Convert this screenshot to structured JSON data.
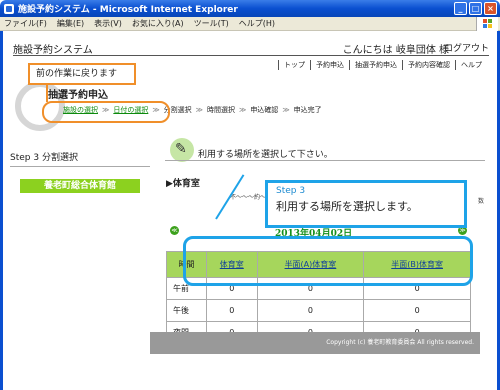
{
  "window": {
    "title": "施設予約システム - Microsoft Internet Explorer",
    "min": "_",
    "max": "□",
    "close": "×"
  },
  "menubar": [
    "ファイル(F)",
    "編集(E)",
    "表示(V)",
    "お気に入り(A)",
    "ツール(T)",
    "ヘルプ(H)"
  ],
  "header": {
    "site_title": "施設予約システム",
    "greeting": "こんにちは 岐阜団体 様",
    "logout": "ログアウト"
  },
  "topnav": [
    "トップ",
    "予約申込",
    "抽選予約申込",
    "予約内容確認",
    "ヘルプ"
  ],
  "page_heading": "抽選予約申込",
  "steps": {
    "done": [
      "施設の選択",
      "日付の選択"
    ],
    "pending": [
      "分割選択",
      "時間選択",
      "申込確認",
      "申込完了"
    ],
    "sep": "≫"
  },
  "left": {
    "step_label": "Step 3  分割選択",
    "facility": "養老町総合体育館"
  },
  "instruction": "利用する場所を選択して下さい。",
  "room_label": "▶体育室",
  "notice": "不〜〜〜約〜〜〜",
  "notice_right": "数",
  "date": "2013年04月02日",
  "nav_prev": "≪",
  "nav_next": "≫",
  "table": {
    "headers": [
      "時間",
      "体育室",
      "半面(A)体育室",
      "半面(B)体育室"
    ],
    "rows": [
      {
        "time": "午前",
        "vals": [
          "0",
          "0",
          "0"
        ]
      },
      {
        "time": "午後",
        "vals": [
          "0",
          "0",
          "0"
        ]
      },
      {
        "time": "夜間",
        "vals": [
          "0",
          "0",
          "0"
        ]
      }
    ]
  },
  "footer": "Copyright (c) 養老町教育委員会 All rights reserved.",
  "callouts": {
    "back": "前の作業に戻ります",
    "step3_label": "Step 3",
    "step3_text": "利用する場所を選択します。"
  },
  "colors": {
    "accent_green": "#8cd11f",
    "callout_orange": "#f08f2a",
    "callout_blue": "#1ea3e8"
  }
}
